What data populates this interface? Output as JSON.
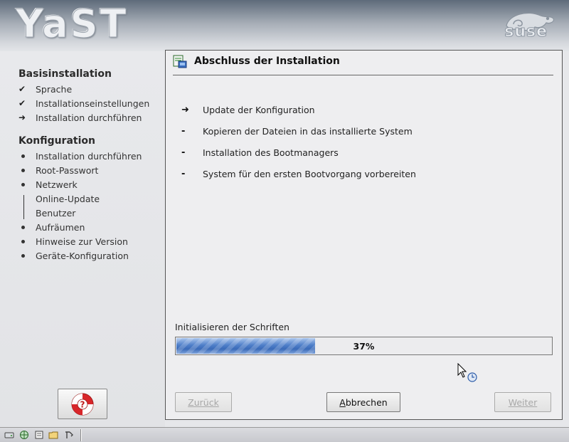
{
  "header": {
    "yast_logo": "YaST",
    "suse_logo": "suse"
  },
  "sidebar": {
    "sections": [
      {
        "title": "Basisinstallation",
        "steps": [
          {
            "label": "Sprache",
            "state": "done"
          },
          {
            "label": "Installationseinstellungen",
            "state": "done"
          },
          {
            "label": "Installation durchführen",
            "state": "current"
          }
        ]
      },
      {
        "title": "Konfiguration",
        "steps": [
          {
            "label": "Installation durchführen",
            "state": "pending"
          },
          {
            "label": "Root-Passwort",
            "state": "pending"
          },
          {
            "label": "Netzwerk",
            "state": "pending"
          },
          {
            "label": "Online-Update",
            "state": "grouped"
          },
          {
            "label": "Benutzer",
            "state": "grouped"
          },
          {
            "label": "Aufräumen",
            "state": "pending"
          },
          {
            "label": "Hinweise zur Version",
            "state": "pending"
          },
          {
            "label": "Geräte-Konfiguration",
            "state": "pending"
          }
        ]
      }
    ],
    "help_icon": "lifebuoy-question-icon"
  },
  "panel": {
    "title": "Abschluss der Installation",
    "tasks": [
      {
        "label": "Update der Konfiguration",
        "state": "current"
      },
      {
        "label": "Kopieren der Dateien in das installierte System",
        "state": "pending"
      },
      {
        "label": "Installation des Bootmanagers",
        "state": "pending"
      },
      {
        "label": "System für den ersten Bootvorgang vorbereiten",
        "state": "pending"
      }
    ],
    "markers": {
      "current": "➜",
      "pending": "-"
    },
    "progress": {
      "label": "Initialisieren der Schriften",
      "percent": 37,
      "text": "37%",
      "color": "#4f7fc9"
    },
    "buttons": {
      "back": {
        "label": "Zurück",
        "enabled": false
      },
      "abort": {
        "label": "Abbrechen",
        "enabled": true
      },
      "next": {
        "label": "Weiter",
        "enabled": false
      }
    }
  },
  "markers": {
    "done": "✔",
    "current": "➜"
  }
}
